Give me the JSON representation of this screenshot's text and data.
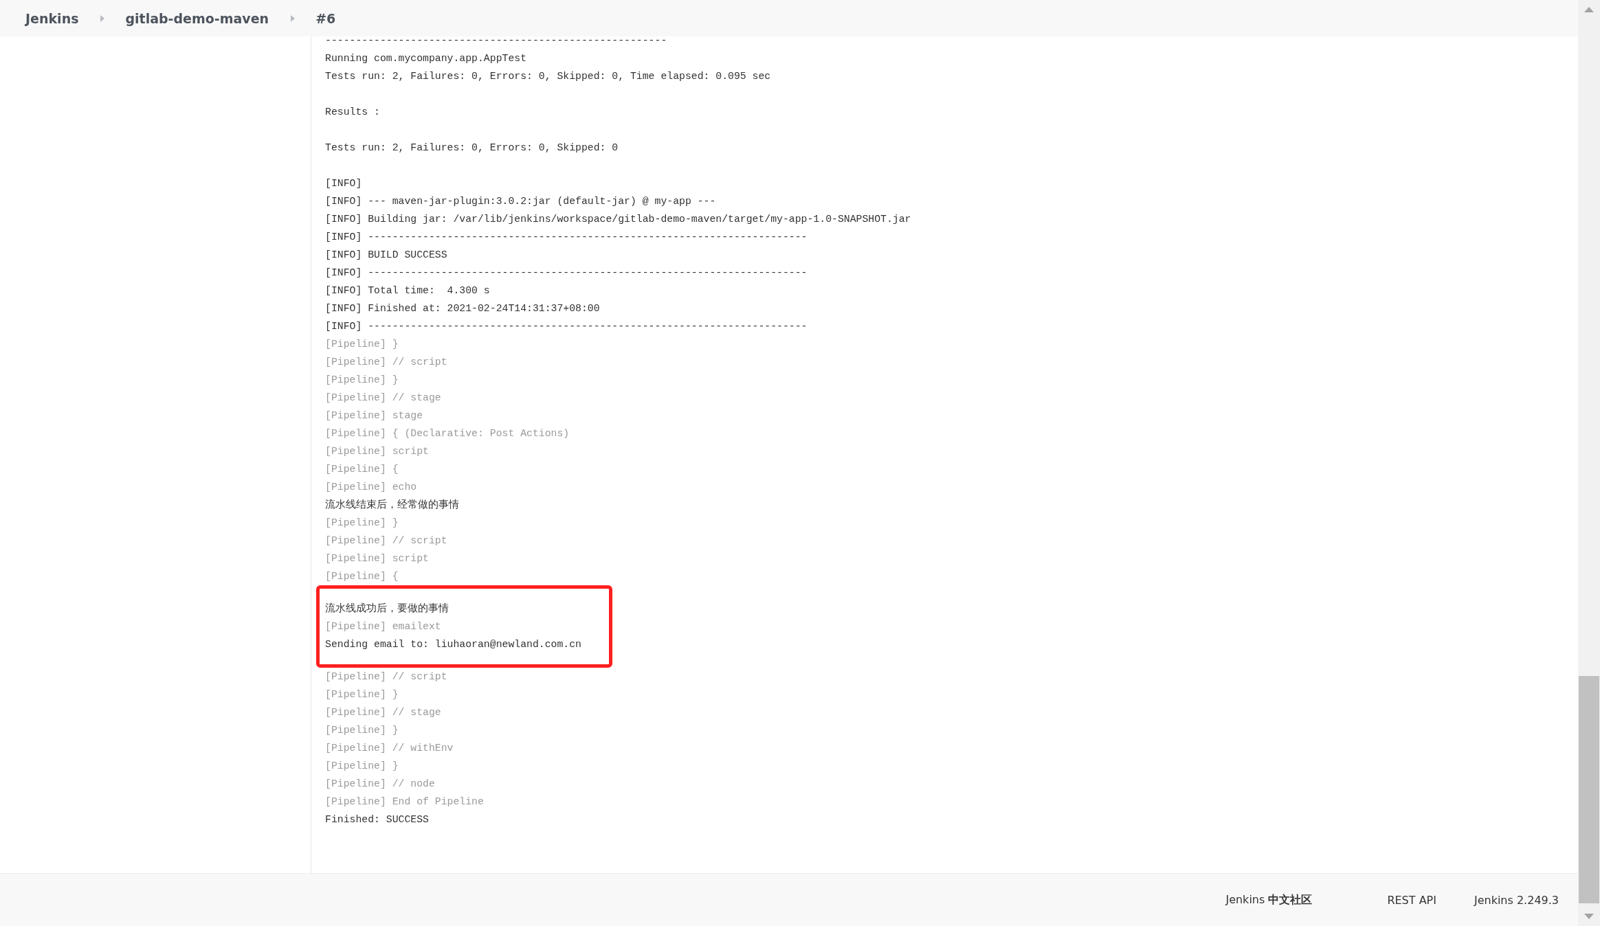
{
  "breadcrumbs": [
    {
      "label": "Jenkins"
    },
    {
      "label": "gitlab-demo-maven"
    },
    {
      "label": "#6"
    }
  ],
  "console": [
    {
      "kind": "plain",
      "text": "--------------------------------------------------------",
      "highlighted": false
    },
    {
      "kind": "plain",
      "text": "Running com.mycompany.app.AppTest",
      "highlighted": false
    },
    {
      "kind": "plain",
      "text": "Tests run: 2, Failures: 0, Errors: 0, Skipped: 0, Time elapsed: 0.095 sec",
      "highlighted": false
    },
    {
      "kind": "blank"
    },
    {
      "kind": "plain",
      "text": "Results :",
      "highlighted": false
    },
    {
      "kind": "blank"
    },
    {
      "kind": "plain",
      "text": "Tests run: 2, Failures: 0, Errors: 0, Skipped: 0",
      "highlighted": false
    },
    {
      "kind": "blank"
    },
    {
      "kind": "plain",
      "text": "[INFO]",
      "highlighted": false
    },
    {
      "kind": "plain",
      "text": "[INFO] --- maven-jar-plugin:3.0.2:jar (default-jar) @ my-app ---",
      "highlighted": false
    },
    {
      "kind": "plain",
      "text": "[INFO] Building jar: /var/lib/jenkins/workspace/gitlab-demo-maven/target/my-app-1.0-SNAPSHOT.jar",
      "highlighted": false
    },
    {
      "kind": "plain",
      "text": "[INFO] ------------------------------------------------------------------------",
      "highlighted": false
    },
    {
      "kind": "plain",
      "text": "[INFO] BUILD SUCCESS",
      "highlighted": false
    },
    {
      "kind": "plain",
      "text": "[INFO] ------------------------------------------------------------------------",
      "highlighted": false
    },
    {
      "kind": "plain",
      "text": "[INFO] Total time:  4.300 s",
      "highlighted": false
    },
    {
      "kind": "plain",
      "text": "[INFO] Finished at: 2021-02-24T14:31:37+08:00",
      "highlighted": false
    },
    {
      "kind": "plain",
      "text": "[INFO] ------------------------------------------------------------------------",
      "highlighted": false
    },
    {
      "kind": "pipeline",
      "text": "[Pipeline] }",
      "highlighted": false
    },
    {
      "kind": "pipeline",
      "text": "[Pipeline] // script",
      "highlighted": false
    },
    {
      "kind": "pipeline",
      "text": "[Pipeline] }",
      "highlighted": false
    },
    {
      "kind": "pipeline",
      "text": "[Pipeline] // stage",
      "highlighted": false
    },
    {
      "kind": "pipeline",
      "text": "[Pipeline] stage",
      "highlighted": false
    },
    {
      "kind": "pipeline",
      "text": "[Pipeline] { (Declarative: Post Actions)",
      "highlighted": false
    },
    {
      "kind": "pipeline",
      "text": "[Pipeline] script",
      "highlighted": false
    },
    {
      "kind": "pipeline",
      "text": "[Pipeline] {",
      "highlighted": false
    },
    {
      "kind": "pipeline",
      "text": "[Pipeline] echo",
      "highlighted": false
    },
    {
      "kind": "plain",
      "text": "流水线结束后，经常做的事情",
      "highlighted": false
    },
    {
      "kind": "pipeline",
      "text": "[Pipeline] }",
      "highlighted": false
    },
    {
      "kind": "pipeline",
      "text": "[Pipeline] // script",
      "highlighted": false
    },
    {
      "kind": "pipeline",
      "text": "[Pipeline] script",
      "highlighted": false
    },
    {
      "kind": "pipeline",
      "text": "[Pipeline] {",
      "highlighted": false
    },
    {
      "kind": "plain",
      "text": "流水线成功后，要做的事情",
      "highlighted": true
    },
    {
      "kind": "pipeline",
      "text": "[Pipeline] emailext",
      "highlighted": true
    },
    {
      "kind": "plain",
      "text": "Sending email to: liuhaoran@newland.com.cn",
      "highlighted": true
    },
    {
      "kind": "pipeline",
      "text": "[Pipeline] // script",
      "highlighted": false
    },
    {
      "kind": "pipeline",
      "text": "[Pipeline] }",
      "highlighted": false
    },
    {
      "kind": "pipeline",
      "text": "[Pipeline] // stage",
      "highlighted": false
    },
    {
      "kind": "pipeline",
      "text": "[Pipeline] }",
      "highlighted": false
    },
    {
      "kind": "pipeline",
      "text": "[Pipeline] // withEnv",
      "highlighted": false
    },
    {
      "kind": "pipeline",
      "text": "[Pipeline] }",
      "highlighted": false
    },
    {
      "kind": "pipeline",
      "text": "[Pipeline] // node",
      "highlighted": false
    },
    {
      "kind": "pipeline",
      "text": "[Pipeline] End of Pipeline",
      "highlighted": false
    },
    {
      "kind": "plain",
      "text": "Finished: SUCCESS",
      "highlighted": false
    }
  ],
  "footer": {
    "links": [
      {
        "label": "Jenkins **中文社区**"
      },
      {
        "label": "REST API"
      },
      {
        "label": "Jenkins 2.249.3"
      }
    ]
  }
}
